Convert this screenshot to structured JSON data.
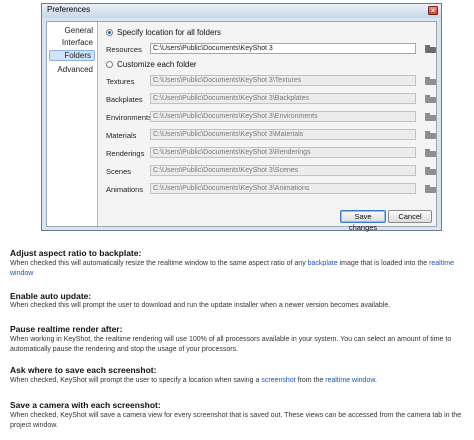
{
  "dialog": {
    "title": "Preferences",
    "sidebar": [
      "General",
      "Interface",
      "Folders",
      "Advanced"
    ],
    "selected_sidebar": "Folders",
    "specify_location_label": "Specify location for all folders",
    "resources_label": "Resources",
    "resources_value": "C:\\Users\\Public\\Documents\\KeyShot 3",
    "customize_label": "Customize each folder",
    "folders": [
      {
        "label": "Textures",
        "value": "C:\\Users\\Public\\Documents\\KeyShot 3\\Textures"
      },
      {
        "label": "Backplates",
        "value": "C:\\Users\\Public\\Documents\\KeyShot 3\\Backplates"
      },
      {
        "label": "Environments",
        "value": "C:\\Users\\Public\\Documents\\KeyShot 3\\Environments"
      },
      {
        "label": "Materials",
        "value": "C:\\Users\\Public\\Documents\\KeyShot 3\\Materials"
      },
      {
        "label": "Renderings",
        "value": "C:\\Users\\Public\\Documents\\KeyShot 3\\Renderings"
      },
      {
        "label": "Scenes",
        "value": "C:\\Users\\Public\\Documents\\KeyShot 3\\Scenes"
      },
      {
        "label": "Animations",
        "value": "C:\\Users\\Public\\Documents\\KeyShot 3\\Animations"
      }
    ],
    "save_label": "Save changes",
    "cancel_label": "Cancel"
  },
  "sections": [
    {
      "title": "Adjust aspect ratio to backplate:",
      "body_1": "When checked this will automatically resize the realtime window to the same aspect ratio of any ",
      "link_1": "backplate",
      "body_2": " image that is loaded into the ",
      "link_2": "realtime window"
    },
    {
      "title": "Enable auto update:",
      "body": "When checked this will prompt the user to download and run the update installer when a newer version becomes available."
    },
    {
      "title": "Pause realtime render after:",
      "body": "When working in KeyShot, the realtime rendering will use 100% of all processors available in your system. You can select an amount of time to automatically pause the rendering and stop the usage of your processors."
    },
    {
      "title": "Ask where to save each screenshot:",
      "body_1": "When checked, KeyShot will prompt the user to specify a location when saving a ",
      "link_1": "screenshot",
      "body_2": " from the ",
      "link_2": "realtime window",
      "body_3": "."
    },
    {
      "title": "Save a camera with each screenshot:",
      "body": "When checked, KeyShot will save a camera view for every screenshot that is saved out. These views can be accessed from the camera tab in the project window."
    }
  ]
}
